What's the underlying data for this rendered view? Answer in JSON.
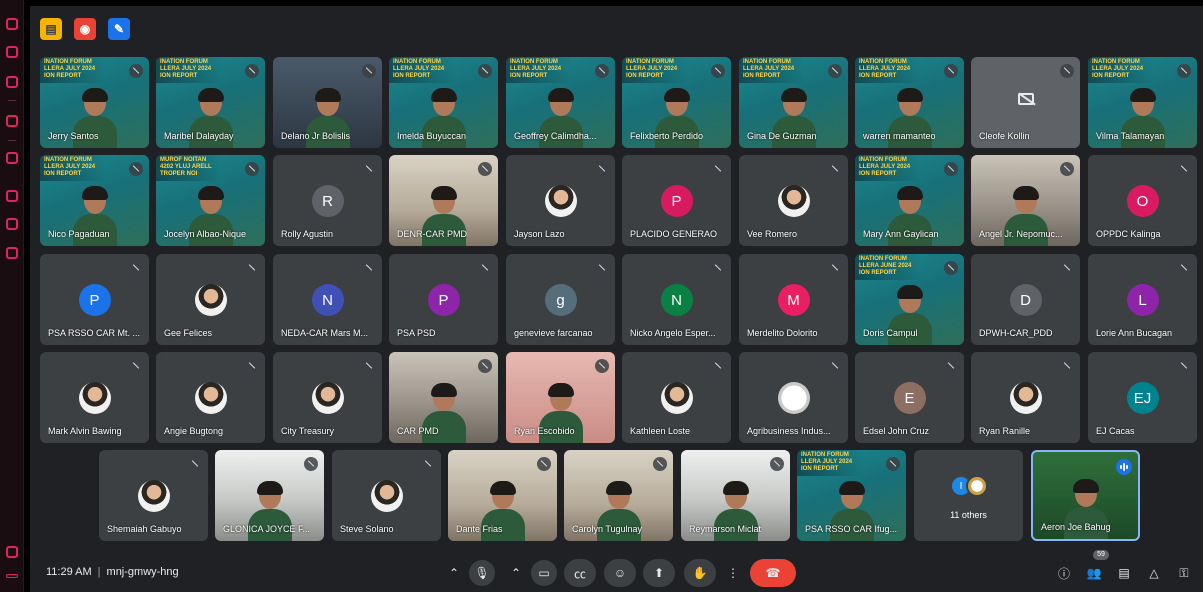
{
  "top_toolbar": {
    "icons": [
      "notes-icon",
      "record-icon",
      "edit-icon"
    ],
    "colors": [
      "#f4b400",
      "#ea4335",
      "#1a73e8"
    ]
  },
  "participants": [
    {
      "name": "Jerry Santos"
    },
    {
      "name": "Maribel Dalayday"
    },
    {
      "name": "Delano Jr Bolislis"
    },
    {
      "name": "Imelda Buyuccan"
    },
    {
      "name": "Geoffrey Calimdha..."
    },
    {
      "name": "Felixberto Perdido"
    },
    {
      "name": "Gina De Guzman"
    },
    {
      "name": "warren mamanteo"
    },
    {
      "name": "Cleofe Kollin"
    },
    {
      "name": "Vilma Talamayan"
    },
    {
      "name": "Nico Pagaduan"
    },
    {
      "name": "Jocelyn Albao-Nique"
    },
    {
      "name": "Rolly Agustin",
      "initial": "R"
    },
    {
      "name": "DENR-CAR PMD"
    },
    {
      "name": "Jayson Lazo"
    },
    {
      "name": "PLACIDO GENERAO",
      "initial": "P"
    },
    {
      "name": "Vee Romero"
    },
    {
      "name": "Mary Ann Gaylican"
    },
    {
      "name": "Angel Jr. Nepomuc..."
    },
    {
      "name": "OPPDC Kalinga",
      "initial": "O"
    },
    {
      "name": "PSA RSSO CAR Mt. ...",
      "initial": "P"
    },
    {
      "name": "Gee Felices"
    },
    {
      "name": "NEDA-CAR Mars M...",
      "initial": "N"
    },
    {
      "name": "PSA PSD",
      "initial": "P"
    },
    {
      "name": "genevieve farcanao",
      "initial": "g"
    },
    {
      "name": "Nicko Angelo Esper...",
      "initial": "N"
    },
    {
      "name": "Merdelito Dolorito",
      "initial": "M"
    },
    {
      "name": "Doris Campul"
    },
    {
      "name": "DPWH-CAR_PDD",
      "initial": "D"
    },
    {
      "name": "Lorie Ann Bucagan",
      "initial": "L"
    },
    {
      "name": "Mark Alvin Bawing"
    },
    {
      "name": "Angie Bugtong"
    },
    {
      "name": "City Treasury"
    },
    {
      "name": "CAR PMD"
    },
    {
      "name": "Ryan Escobido"
    },
    {
      "name": "Kathleen Loste"
    },
    {
      "name": "Agribusiness Indus..."
    },
    {
      "name": "Edsel John Cruz",
      "initial": "E"
    },
    {
      "name": "Ryan Ranille"
    },
    {
      "name": "EJ Cacas",
      "initial": "EJ"
    },
    {
      "name": "Shemaiah Gabuyo"
    },
    {
      "name": "GLONICA JOYCE F..."
    },
    {
      "name": "Steve Solano"
    },
    {
      "name": "Dante Frias"
    },
    {
      "name": "Carolyn Tugulnay"
    },
    {
      "name": "Reymarson Miclat"
    },
    {
      "name": "PSA RSSO CAR Ifug..."
    },
    {
      "name": "Aeron Joe Bahug"
    }
  ],
  "forum_banner": {
    "july": "INATION FORUM\nLLERA JULY 2024\nION REPORT",
    "june": "INATION FORUM\nLLERA JUNE 2024\nION REPORT",
    "mirrored": "MUROF NOITAN\n4202 YLUJ ARELL\nTROPER NOI"
  },
  "others_tile": {
    "label": "11 others",
    "initial": "I"
  },
  "bottom_bar": {
    "time": "11:29 AM",
    "separator": "|",
    "meeting_code": "mnj-gmwy-hng",
    "participant_count": "59"
  },
  "avatar_colors": {
    "grey": "#5f6368",
    "pink": "#d81b60",
    "blue": "#1a73e8",
    "indigo": "#3f51b5",
    "purple": "#8e24aa",
    "slate": "#546e7a",
    "green": "#0b8043",
    "rose": "#e91e63",
    "magenta": "#c2185b",
    "teal": "#00838f",
    "brown": "#8d6e63",
    "lightblue": "#1e88e5"
  }
}
